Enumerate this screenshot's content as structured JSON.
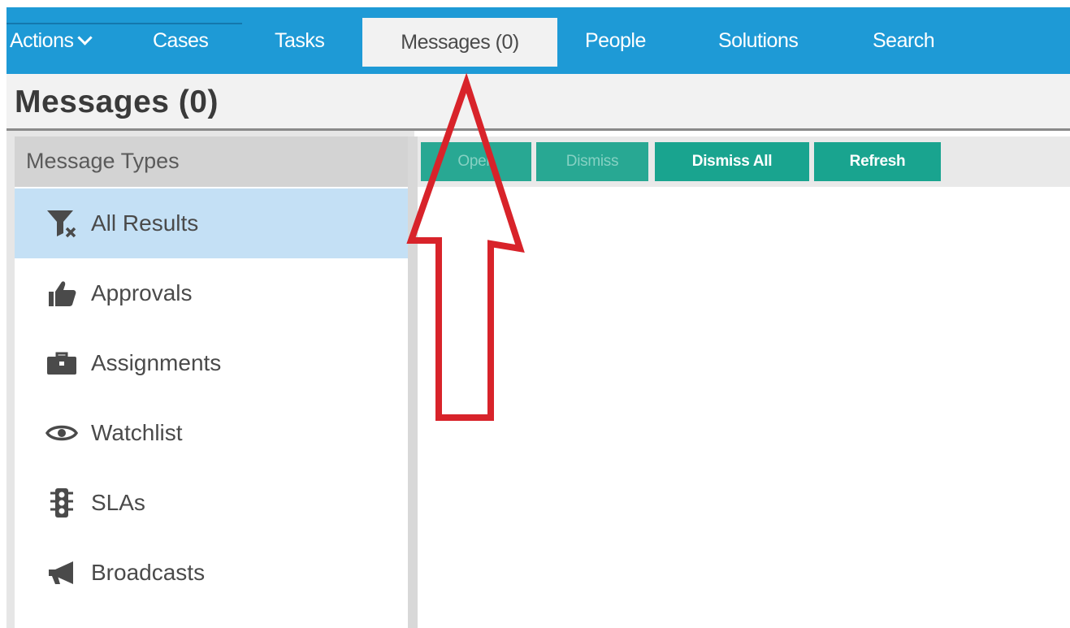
{
  "nav": {
    "tabs": [
      {
        "label": "Actions",
        "has_dropdown": true
      },
      {
        "label": "Cases"
      },
      {
        "label": "Tasks"
      },
      {
        "label": "Messages (0)",
        "active": true
      },
      {
        "label": "People"
      },
      {
        "label": "Solutions"
      },
      {
        "label": "Search"
      }
    ]
  },
  "page": {
    "title": "Messages (0)"
  },
  "sidebar": {
    "header": "Message Types",
    "items": [
      {
        "label": "All Results",
        "icon": "filter-clear-icon",
        "selected": true
      },
      {
        "label": "Approvals",
        "icon": "thumbs-up-icon"
      },
      {
        "label": "Assignments",
        "icon": "briefcase-icon"
      },
      {
        "label": "Watchlist",
        "icon": "eye-icon"
      },
      {
        "label": "SLAs",
        "icon": "traffic-light-icon"
      },
      {
        "label": "Broadcasts",
        "icon": "megaphone-icon"
      }
    ]
  },
  "toolbar": {
    "open_label": "Open",
    "dismiss_label": "Dismiss",
    "dismiss_all_label": "Dismiss All",
    "refresh_label": "Refresh"
  },
  "colors": {
    "nav_bg": "#1e9ad6",
    "button_bg": "#19a48f",
    "selected_item_bg": "#c4e0f5",
    "annotation_arrow": "#d8232a"
  }
}
